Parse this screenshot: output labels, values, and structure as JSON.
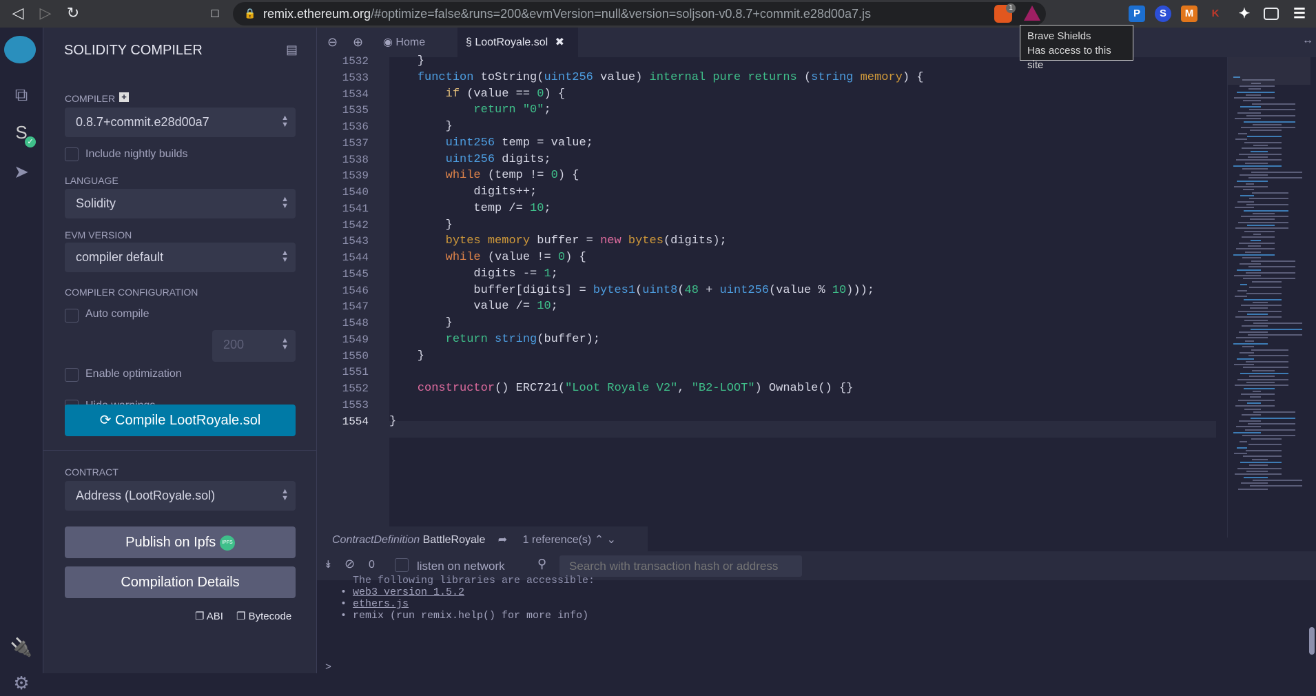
{
  "browser": {
    "url_host": "remix.ethereum.org",
    "url_rest": "/#optimize=false&runs=200&evmVersion=null&version=soljson-v0.8.7+commit.e28d00a7.js",
    "shields_count": "1",
    "tooltip_title": "Brave Shields",
    "tooltip_text": "Has access to this site",
    "extensions": [
      "P",
      "S",
      "M",
      "K"
    ]
  },
  "sidebar": {
    "title": "SOLIDITY COMPILER",
    "compiler_label": "COMPILER",
    "compiler_value": "0.8.7+commit.e28d00a7",
    "nightly_label": "Include nightly builds",
    "language_label": "LANGUAGE",
    "language_value": "Solidity",
    "evm_label": "EVM VERSION",
    "evm_value": "compiler default",
    "config_label": "COMPILER CONFIGURATION",
    "auto_compile": "Auto compile",
    "enable_optimization": "Enable optimization",
    "runs_value": "200",
    "hide_warnings": "Hide warnings",
    "compile_button": "Compile LootRoyale.sol",
    "contract_label": "CONTRACT",
    "contract_value": "Address (LootRoyale.sol)",
    "publish_button": "Publish on Ipfs",
    "ipfs_badge": "IPFS",
    "details_button": "Compilation Details",
    "abi_label": "ABI",
    "bytecode_label": "Bytecode"
  },
  "editor": {
    "tabs": [
      {
        "label": "Home"
      },
      {
        "label": "LootRoyale.sol"
      }
    ],
    "lines": [
      {
        "n": "1532",
        "t": [
          [
            "",
            "    }"
          ]
        ]
      },
      {
        "n": "1533",
        "t": [
          [
            "",
            "    "
          ],
          [
            "k-fn",
            "function"
          ],
          [
            "",
            " toString("
          ],
          [
            "k-ty",
            "uint256"
          ],
          [
            "",
            " value) "
          ],
          [
            "k-gr",
            "internal pure returns"
          ],
          [
            "",
            " ("
          ],
          [
            "k-ty",
            "string"
          ],
          [
            "",
            " "
          ],
          [
            "k-mem",
            "memory"
          ],
          [
            "",
            ") {"
          ]
        ]
      },
      {
        "n": "1534",
        "t": [
          [
            "",
            "        "
          ],
          [
            "k-if",
            "if"
          ],
          [
            "",
            " (value == "
          ],
          [
            "k-num",
            "0"
          ],
          [
            "",
            ") {"
          ]
        ]
      },
      {
        "n": "1535",
        "t": [
          [
            "",
            "            "
          ],
          [
            "k-gr",
            "return"
          ],
          [
            "",
            " "
          ],
          [
            "k-str",
            "\"0\""
          ],
          [
            "",
            ";"
          ]
        ]
      },
      {
        "n": "1536",
        "t": [
          [
            "",
            "        }"
          ]
        ]
      },
      {
        "n": "1537",
        "t": [
          [
            "",
            "        "
          ],
          [
            "k-ty",
            "uint256"
          ],
          [
            "",
            " temp = value;"
          ]
        ]
      },
      {
        "n": "1538",
        "t": [
          [
            "",
            "        "
          ],
          [
            "k-ty",
            "uint256"
          ],
          [
            "",
            " digits;"
          ]
        ]
      },
      {
        "n": "1539",
        "t": [
          [
            "",
            "        "
          ],
          [
            "k-wh",
            "while"
          ],
          [
            "",
            " (temp != "
          ],
          [
            "k-num",
            "0"
          ],
          [
            "",
            ") {"
          ]
        ]
      },
      {
        "n": "1540",
        "t": [
          [
            "",
            "            digits++;"
          ]
        ]
      },
      {
        "n": "1541",
        "t": [
          [
            "",
            "            temp /= "
          ],
          [
            "k-num",
            "10"
          ],
          [
            "",
            ";"
          ]
        ]
      },
      {
        "n": "1542",
        "t": [
          [
            "",
            "        }"
          ]
        ]
      },
      {
        "n": "1543",
        "t": [
          [
            "",
            "        "
          ],
          [
            "k-mem",
            "bytes memory"
          ],
          [
            "",
            " buffer = "
          ],
          [
            "k-pk",
            "new"
          ],
          [
            "",
            " "
          ],
          [
            "k-mem",
            "bytes"
          ],
          [
            "",
            "(digits);"
          ]
        ]
      },
      {
        "n": "1544",
        "t": [
          [
            "",
            "        "
          ],
          [
            "k-wh",
            "while"
          ],
          [
            "",
            " (value != "
          ],
          [
            "k-num",
            "0"
          ],
          [
            "",
            ") {"
          ]
        ]
      },
      {
        "n": "1545",
        "t": [
          [
            "",
            "            digits -= "
          ],
          [
            "k-num",
            "1"
          ],
          [
            "",
            ";"
          ]
        ]
      },
      {
        "n": "1546",
        "t": [
          [
            "",
            "            buffer[digits] = "
          ],
          [
            "k-ty",
            "bytes1"
          ],
          [
            "",
            "("
          ],
          [
            "k-ty",
            "uint8"
          ],
          [
            "",
            "("
          ],
          [
            "k-num",
            "48"
          ],
          [
            "",
            " + "
          ],
          [
            "k-ty",
            "uint256"
          ],
          [
            "",
            "(value % "
          ],
          [
            "k-num",
            "10"
          ],
          [
            "",
            ")));"
          ]
        ]
      },
      {
        "n": "1547",
        "t": [
          [
            "",
            "            value /= "
          ],
          [
            "k-num",
            "10"
          ],
          [
            "",
            ";"
          ]
        ]
      },
      {
        "n": "1548",
        "t": [
          [
            "",
            "        }"
          ]
        ]
      },
      {
        "n": "1549",
        "t": [
          [
            "",
            "        "
          ],
          [
            "k-gr",
            "return"
          ],
          [
            "",
            " "
          ],
          [
            "k-ty",
            "string"
          ],
          [
            "",
            "(buffer);"
          ]
        ]
      },
      {
        "n": "1550",
        "t": [
          [
            "",
            "    }"
          ]
        ]
      },
      {
        "n": "1551",
        "t": [
          [
            "",
            ""
          ]
        ]
      },
      {
        "n": "1552",
        "t": [
          [
            "",
            "    "
          ],
          [
            "k-pk",
            "constructor"
          ],
          [
            "",
            "() ERC721("
          ],
          [
            "k-str",
            "\"Loot Royale V2\""
          ],
          [
            "",
            ", "
          ],
          [
            "k-str",
            "\"B2-LOOT\""
          ],
          [
            "",
            ") Ownable() {}"
          ]
        ]
      },
      {
        "n": "1553",
        "t": [
          [
            "",
            ""
          ]
        ]
      },
      {
        "n": "1554",
        "t": [
          [
            "",
            "}"
          ]
        ]
      }
    ]
  },
  "references": {
    "kind": "ContractDefinition",
    "name": "BattleRoyale",
    "count": "1 reference(s)"
  },
  "terminal": {
    "pending_count": "0",
    "listen_label": "listen on network",
    "search_placeholder": "Search with transaction hash or address",
    "cut_line": "The following libraries are accessible:",
    "items": [
      "web3 version 1.5.2",
      "ethers.js",
      "remix (run remix.help() for more info)"
    ],
    "prompt": ">"
  }
}
